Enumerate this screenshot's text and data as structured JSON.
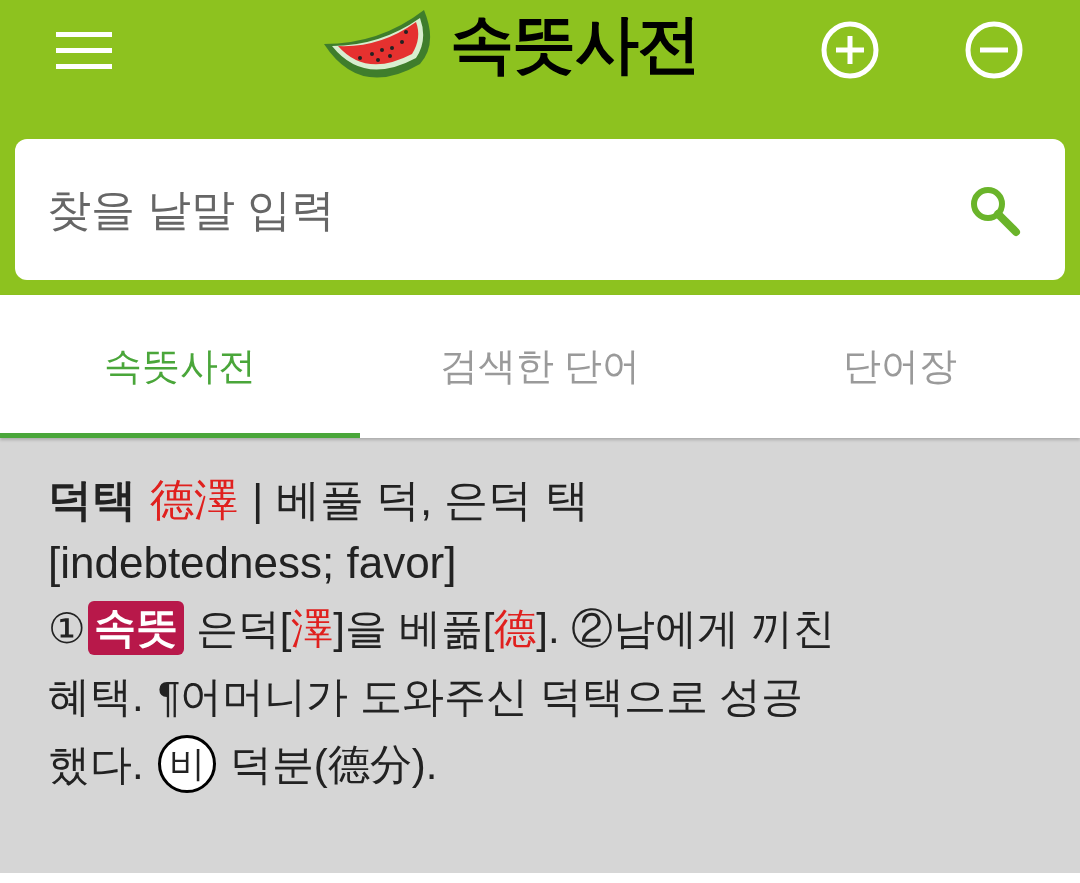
{
  "header": {
    "title": "속뜻사전"
  },
  "search": {
    "placeholder": "찾을 낱말 입력"
  },
  "tabs": [
    {
      "label": "속뜻사전",
      "selected": true
    },
    {
      "label": "검색한 단어",
      "selected": false
    },
    {
      "label": "단어장",
      "selected": false
    }
  ],
  "entry": {
    "word": "덕택",
    "hanja": "德澤",
    "reading": "| 베풀 덕, 은덕 택",
    "english": "[indebtedness; favor]",
    "definition": [
      [
        {
          "kind": "text",
          "text": "①"
        },
        {
          "kind": "badge",
          "text": "속뜻"
        },
        {
          "kind": "text",
          "text": " 은덕["
        },
        {
          "kind": "hanja",
          "text": "澤"
        },
        {
          "kind": "text",
          "text": "]을 베풂["
        },
        {
          "kind": "hanja",
          "text": "德"
        },
        {
          "kind": "text",
          "text": "]. ②남에게 끼친"
        }
      ],
      [
        {
          "kind": "text",
          "text": "혜택."
        },
        {
          "kind": "text",
          "text": "¶어머니가 도와주신 덕택으로 성공"
        }
      ],
      [
        {
          "kind": "text",
          "text": "했다."
        },
        {
          "kind": "circle",
          "text": "비"
        },
        {
          "kind": "text",
          "text": "덕분(德分)."
        }
      ]
    ]
  }
}
